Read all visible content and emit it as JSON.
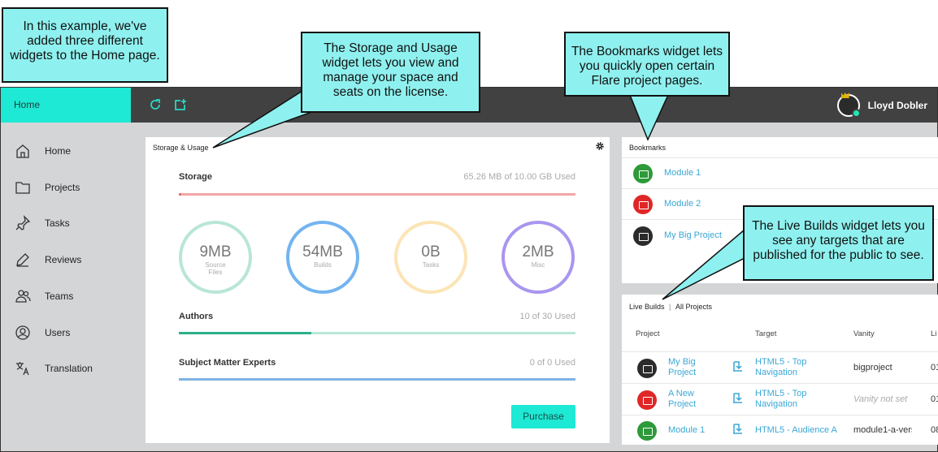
{
  "callouts": {
    "intro": "In this example, we've added three different widgets to the Home page.",
    "storage": "The Storage and Usage widget lets you view and manage your space and seats on the license.",
    "bookmarks": "The Bookmarks widget lets you quickly open certain Flare project pages.",
    "live_builds": "The Live Builds widget lets you see any targets that are published for the public to see."
  },
  "topbar": {
    "home_tab": "Home",
    "refresh_icon": "refresh-icon",
    "add_icon": "add-widget-icon",
    "user_name": "Lloyd Dobler"
  },
  "sidebar": {
    "items": [
      {
        "label": "Home",
        "icon": "home-icon"
      },
      {
        "label": "Projects",
        "icon": "folder-icon"
      },
      {
        "label": "Tasks",
        "icon": "pin-icon"
      },
      {
        "label": "Reviews",
        "icon": "pen-icon"
      },
      {
        "label": "Teams",
        "icon": "team-icon"
      },
      {
        "label": "Users",
        "icon": "user-icon"
      },
      {
        "label": "Translation",
        "icon": "translate-icon"
      }
    ]
  },
  "storage_widget": {
    "title": "Storage & Usage",
    "storage_label": "Storage",
    "storage_value": "65.26 MB of 10.00 GB Used",
    "storage_fraction": 0.0065,
    "circles": [
      {
        "value": "9MB",
        "label_line1": "Source",
        "label_line2": "Files",
        "color": "#b9e6d6"
      },
      {
        "value": "54MB",
        "label_line1": "Builds",
        "label_line2": "",
        "color": "#73b4f0"
      },
      {
        "value": "0B",
        "label_line1": "Tasks",
        "label_line2": "",
        "color": "#fce4b6"
      },
      {
        "value": "2MB",
        "label_line1": "Misc",
        "label_line2": "",
        "color": "#a996ee"
      }
    ],
    "authors_label": "Authors",
    "authors_value": "10 of 30 Used",
    "authors_fraction": 0.333,
    "sme_label": "Subject Matter Experts",
    "sme_value": "0 of 0 Used",
    "purchase_button": "Purchase"
  },
  "bookmarks_widget": {
    "title": "Bookmarks",
    "items": [
      {
        "label": "Module 1",
        "color": "#2e9a3a"
      },
      {
        "label": "Module 2",
        "color": "#e02727"
      },
      {
        "label": "My Big Project",
        "color": "#2b2b2b"
      }
    ]
  },
  "live_builds_widget": {
    "title": "Live Builds",
    "separator": "|",
    "all_projects": "All Projects",
    "columns": [
      "Project",
      "Target",
      "Vanity",
      "Li"
    ],
    "rows": [
      {
        "project_line1": "My Big",
        "project_line2": "Project",
        "target_line1": "HTML5 - Top",
        "target_line2": "Navigation",
        "vanity": "bigproject",
        "extra": "01",
        "color": "#2b2b2b",
        "vanity_muted": false
      },
      {
        "project_line1": "A New",
        "project_line2": "Project",
        "target_line1": "HTML5 - Top",
        "target_line2": "Navigation",
        "vanity": "Vanity not set",
        "extra": "01",
        "color": "#e02727",
        "vanity_muted": true
      },
      {
        "project_line1": "Module 1",
        "project_line2": "",
        "target_line1": "HTML5 - Audience A",
        "target_line2": "",
        "vanity": "module1-a-versi",
        "extra": "08",
        "color": "#2e9a3a",
        "vanity_muted": false
      }
    ]
  },
  "colors": {
    "accent": "#1de9d4",
    "topbar": "#414141",
    "callout": "#8ff1ef",
    "link": "#3aa7d6",
    "storage_bar": "#f3a6a6",
    "authors_bar": "#2bb08a",
    "authors_track": "#b9e6d6",
    "sme_bar": "#7fb2e5"
  }
}
